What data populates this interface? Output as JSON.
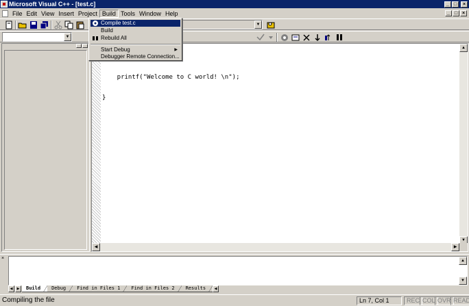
{
  "window": {
    "title": "Microsoft Visual C++ - [test.c]",
    "buttons": {
      "minimize": "_",
      "maximize": "□",
      "close": "×"
    }
  },
  "menu": {
    "items": [
      "File",
      "Edit",
      "View",
      "Insert",
      "Project",
      "Build",
      "Tools",
      "Window",
      "Help"
    ],
    "active": "Build"
  },
  "build_menu": {
    "items": [
      {
        "label": "Compile test.c",
        "highlighted": true,
        "icon": "compile-icon"
      },
      {
        "label": "Build",
        "highlighted": false
      },
      {
        "label": "Rebuild All",
        "highlighted": false,
        "icon": "rebuild-icon"
      },
      {
        "label": "Start Debug",
        "highlighted": false,
        "submenu": true
      },
      {
        "label": "Debugger Remote Connection...",
        "highlighted": false
      }
    ]
  },
  "editor": {
    "code_lines": [
      "    printf(\"Welcome to C world! \\n\");",
      "}"
    ]
  },
  "output": {
    "tabs": [
      "Build",
      "Debug",
      "Find in Files 1",
      "Find in Files 2",
      "Results"
    ],
    "active_tab": "Build"
  },
  "status": {
    "message": "Compiling the file",
    "position": "Ln 7, Col 1",
    "indicators": [
      "REC",
      "COL",
      "OVR",
      "READ"
    ]
  },
  "colors": {
    "title_bar": "#0a246a",
    "chrome": "#d4d0c8",
    "highlight": "#0a246a"
  }
}
